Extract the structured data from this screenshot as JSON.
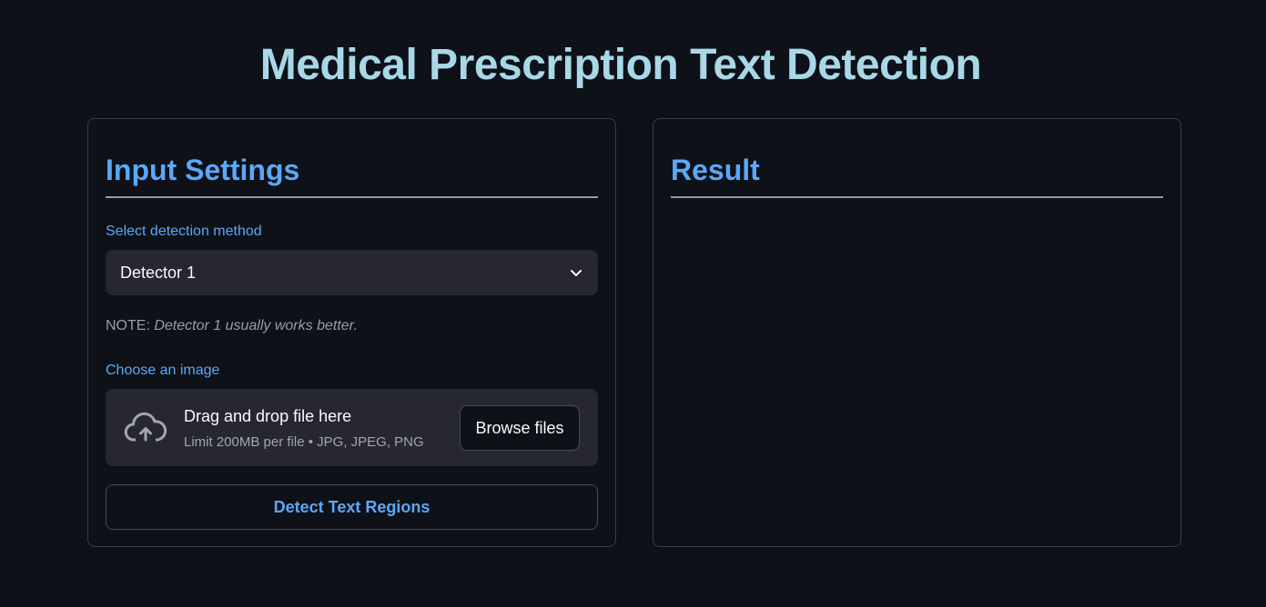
{
  "app": {
    "title": "Medical Prescription Text Detection"
  },
  "input_panel": {
    "heading": "Input Settings",
    "method_label": "Select detection method",
    "method_selected": "Detector 1",
    "note_prefix": "NOTE:",
    "note_body": "Detector 1 usually works better.",
    "image_label": "Choose an image",
    "uploader": {
      "main_text": "Drag and drop file here",
      "sub_text": "Limit 200MB per file • JPG, JPEG, PNG",
      "browse_label": "Browse files",
      "icon": "cloud-upload-icon"
    },
    "detect_label": "Detect Text Regions"
  },
  "result_panel": {
    "heading": "Result"
  },
  "colors": {
    "background": "#0e1117",
    "title": "#a8d8e8",
    "accent": "#5aa8f8",
    "widget": "#262730"
  }
}
